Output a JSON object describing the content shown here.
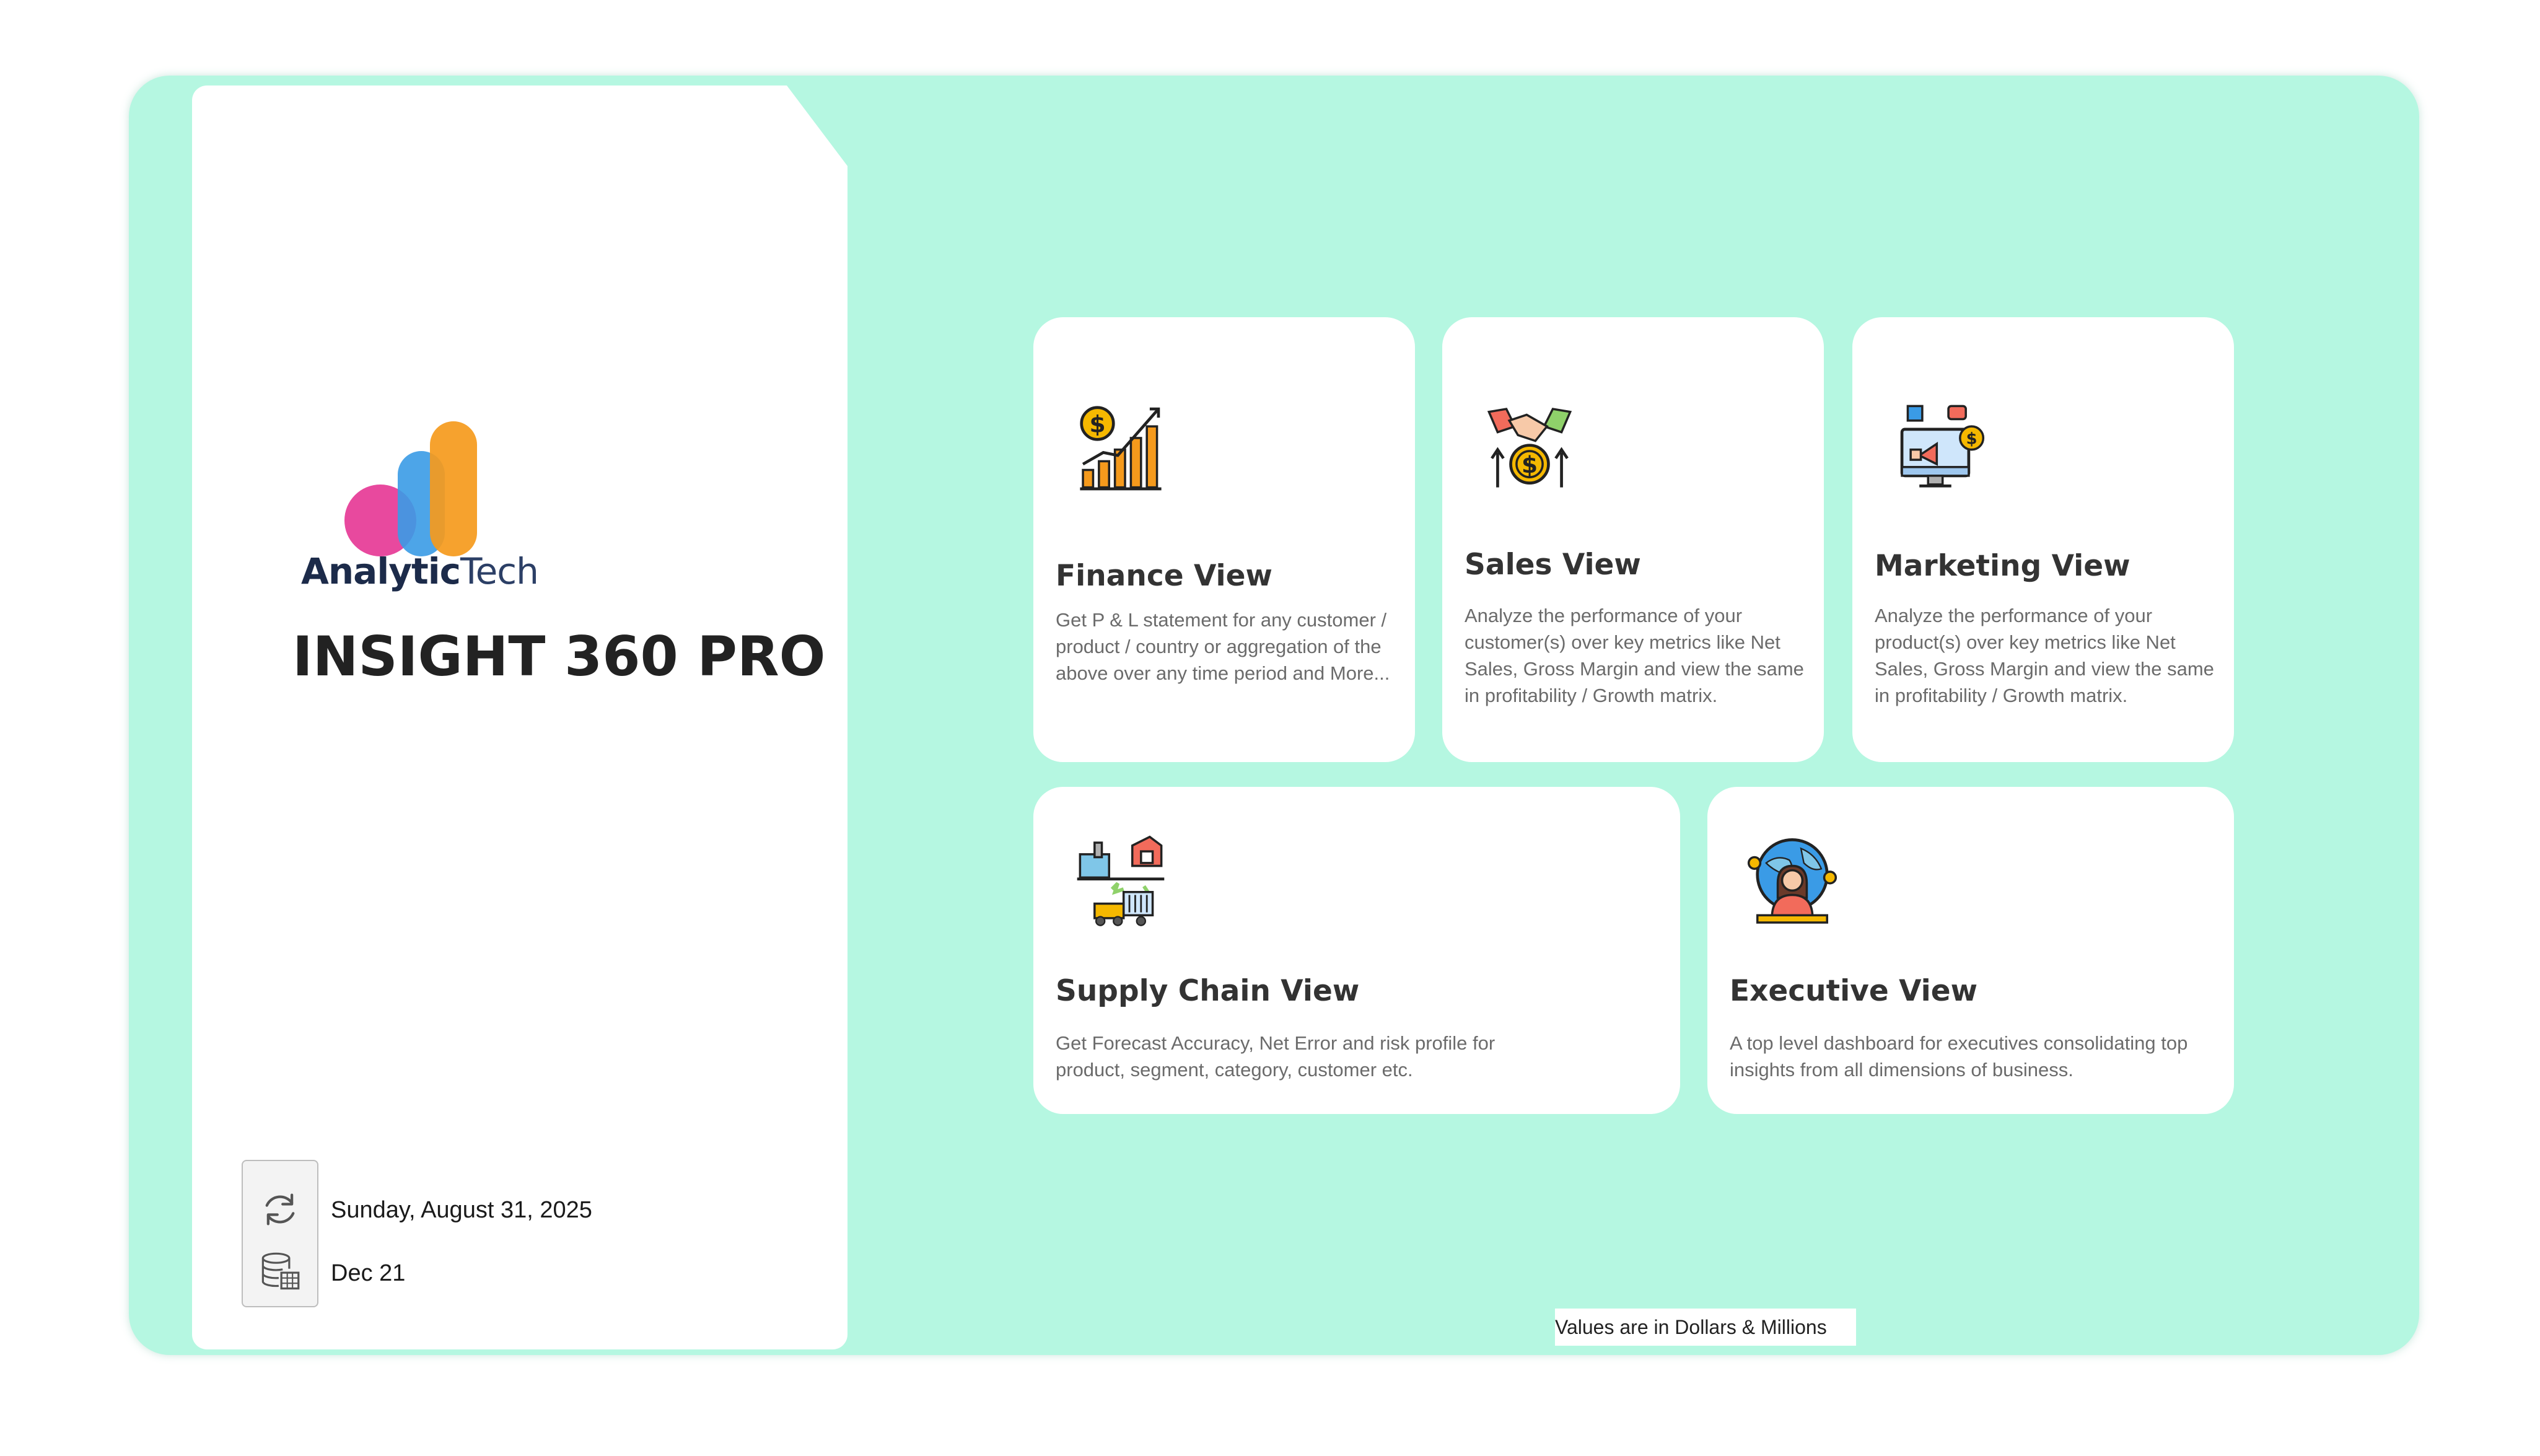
{
  "brand": {
    "logo_text_bold": "Analytic",
    "logo_text_light": "Tech",
    "app_title": "INSIGHT 360 PRO",
    "colors": {
      "background": "#b5f7e1",
      "logo_pink": "#e63a96",
      "logo_blue": "#3a9be6",
      "logo_orange": "#f59a1c"
    }
  },
  "refresh_info": {
    "refresh_icon": "refresh-icon",
    "data_icon": "database-table-icon",
    "last_refresh": "Sunday, August 31, 2025",
    "data_through": "Dec 21"
  },
  "cards": {
    "finance": {
      "icon": "finance-growth-chart-icon",
      "title": "Finance View",
      "description": "Get P & L statement for any customer / product / country or aggregation of the above over any time period and More..."
    },
    "sales": {
      "icon": "handshake-dollar-icon",
      "title": "Sales View",
      "description": "Analyze the performance of your customer(s) over key metrics like Net Sales, Gross Margin and view the same in profitability / Growth matrix."
    },
    "marketing": {
      "icon": "marketing-monitor-megaphone-icon",
      "title": "Marketing View",
      "description": "Analyze the performance of your product(s) over key metrics like Net Sales, Gross Margin and view the same in profitability / Growth matrix."
    },
    "supply_chain": {
      "icon": "supply-chain-factory-icon",
      "title": "Supply Chain View",
      "description": "Get Forecast Accuracy, Net Error and risk profile for product, segment, category, customer etc."
    },
    "executive": {
      "icon": "executive-globe-person-icon",
      "title": "Executive View",
      "description": "A top level dashboard for executives consolidating top insights from all dimensions of business."
    }
  },
  "footnote": "Values are in Dollars & Millions"
}
